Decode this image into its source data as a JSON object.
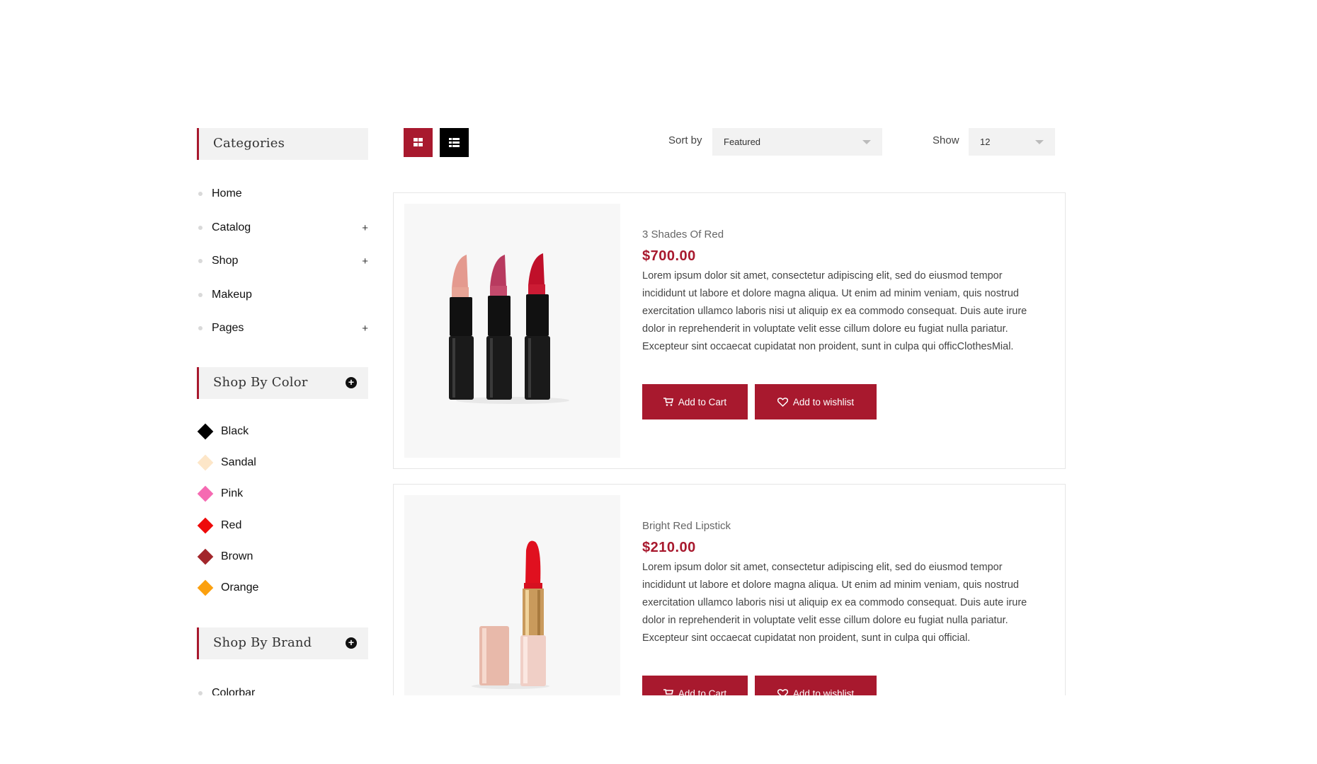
{
  "sidebar": {
    "categories_title": "Categories",
    "categories": [
      {
        "label": "Home",
        "expandable": false
      },
      {
        "label": "Catalog",
        "expandable": true
      },
      {
        "label": "Shop",
        "expandable": true
      },
      {
        "label": "Makeup",
        "expandable": false
      },
      {
        "label": "Pages",
        "expandable": true
      }
    ],
    "expand_symbol": "+",
    "color_title": "Shop By Color",
    "colors": [
      {
        "label": "Black",
        "hex": "#000000"
      },
      {
        "label": "Sandal",
        "hex": "#fde6c8"
      },
      {
        "label": "Pink",
        "hex": "#f56ab2"
      },
      {
        "label": "Red",
        "hex": "#ee0a0a"
      },
      {
        "label": "Brown",
        "hex": "#a2262b"
      },
      {
        "label": "Orange",
        "hex": "#fba00f"
      }
    ],
    "brand_title": "Shop By Brand",
    "brands": [
      {
        "label": "Colorbar"
      }
    ]
  },
  "toolbar": {
    "sort_label": "Sort by",
    "sort_value": "Featured",
    "show_label": "Show",
    "show_value": "12"
  },
  "products": [
    {
      "name": "3 Shades Of Red",
      "price": "$700.00",
      "description": "Lorem ipsum dolor sit amet, consectetur adipiscing elit, sed do eiusmod tempor incididunt ut labore et dolore magna aliqua. Ut enim ad minim veniam, quis nostrud exercitation ullamco laboris nisi ut aliquip ex ea commodo consequat. Duis aute irure dolor in reprehenderit in voluptate velit esse cillum dolore eu fugiat nulla pariatur. Excepteur sint occaecat cupidatat non proident, sunt in culpa qui officClothesMial.",
      "add_to_cart": "Add to Cart",
      "add_to_wishlist": "Add to wishlist"
    },
    {
      "name": "Bright Red Lipstick",
      "price": "$210.00",
      "description": "Lorem ipsum dolor sit amet, consectetur adipiscing elit, sed do eiusmod tempor incididunt ut labore et dolore magna aliqua. Ut enim ad minim veniam, quis nostrud exercitation ullamco laboris nisi ut aliquip ex ea commodo consequat. Duis aute irure dolor in reprehenderit in voluptate velit esse cillum dolore eu fugiat nulla pariatur. Excepteur sint occaecat cupidatat non proident, sunt in culpa qui official.",
      "add_to_cart": "Add to Cart",
      "add_to_wishlist": "Add to wishlist"
    }
  ],
  "colors": {
    "accent": "#a8192e",
    "panel": "#f2f2f2"
  }
}
